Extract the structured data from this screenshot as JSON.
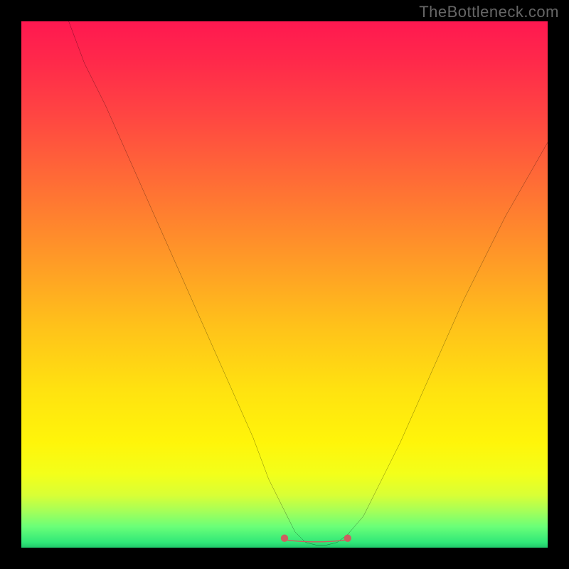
{
  "watermark": "TheBottleneck.com",
  "chart_data": {
    "type": "line",
    "title": "",
    "xlabel": "",
    "ylabel": "",
    "xlim": [
      0,
      100
    ],
    "ylim": [
      0,
      100
    ],
    "series": [
      {
        "name": "bottleneck-curve",
        "color": "#000000",
        "x": [
          9,
          12,
          16,
          20,
          24,
          28,
          32,
          36,
          40,
          44,
          47,
          50,
          52,
          54,
          56,
          58,
          60,
          62,
          65,
          68,
          72,
          76,
          80,
          84,
          88,
          92,
          96,
          100
        ],
        "y": [
          100,
          92,
          84,
          75,
          66,
          57,
          48,
          39,
          30,
          21,
          13,
          7,
          3,
          1,
          0.5,
          0.5,
          1,
          2.5,
          6,
          12,
          20,
          29,
          38,
          47,
          55,
          63,
          70,
          77
        ]
      }
    ],
    "highlight": {
      "name": "optimal-range",
      "color": "#cc6060",
      "x_range": [
        50,
        62
      ],
      "y": 1.5
    },
    "gradient": {
      "stops": [
        {
          "pos": 0,
          "color": "#ff1850"
        },
        {
          "pos": 18,
          "color": "#ff4642"
        },
        {
          "pos": 45,
          "color": "#ff9927"
        },
        {
          "pos": 70,
          "color": "#ffe210"
        },
        {
          "pos": 90,
          "color": "#d9ff35"
        },
        {
          "pos": 100,
          "color": "#20c86a"
        }
      ]
    }
  }
}
